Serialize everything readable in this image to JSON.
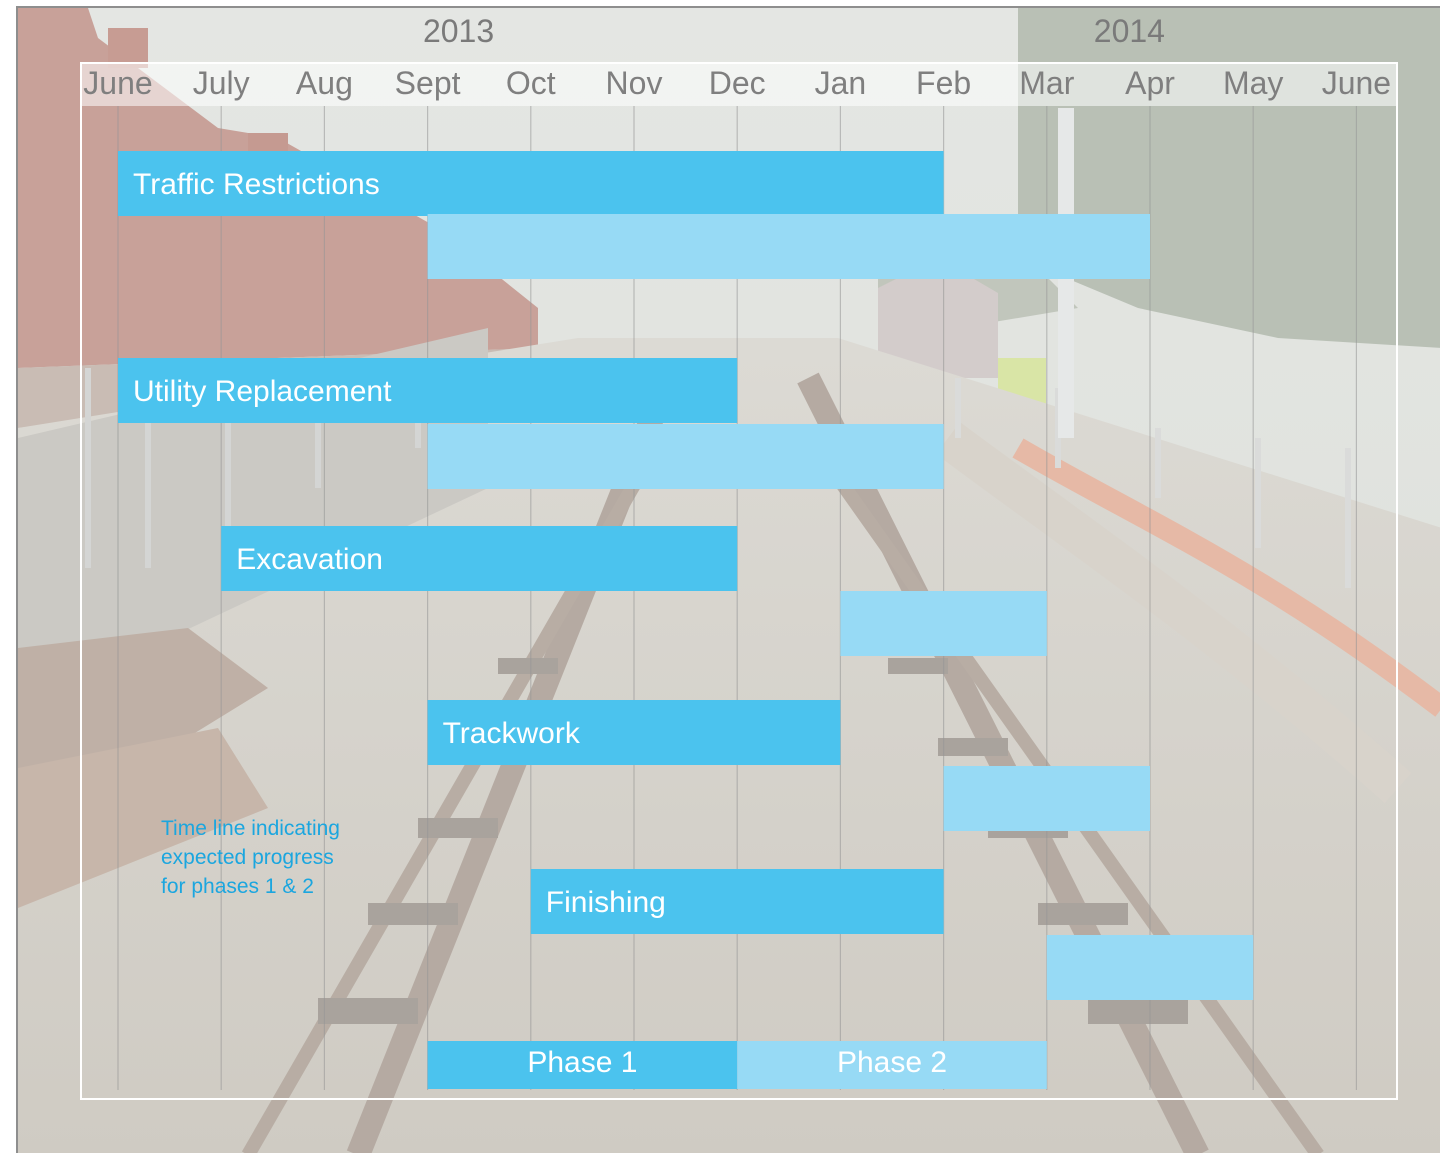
{
  "chart_data": {
    "type": "gantt",
    "years": [
      {
        "label": "2013",
        "month_index": 3.3
      },
      {
        "label": "2014",
        "month_index": 9.8
      }
    ],
    "months": [
      "June",
      "July",
      "Aug",
      "Sept",
      "Oct",
      "Nov",
      "Dec",
      "Jan",
      "Feb",
      "Mar",
      "Apr",
      "May",
      "June"
    ],
    "month_range": [
      0,
      12.4
    ],
    "grid": true,
    "tasks": [
      {
        "name": "Traffic Restrictions",
        "phase": 1,
        "start": 0,
        "end": 8
      },
      {
        "name": "",
        "phase": 2,
        "start": 3,
        "end": 10
      },
      {
        "name": "Utility Replacement",
        "phase": 1,
        "start": 0,
        "end": 6
      },
      {
        "name": "",
        "phase": 2,
        "start": 3,
        "end": 8
      },
      {
        "name": "Excavation",
        "phase": 1,
        "start": 1,
        "end": 6
      },
      {
        "name": "",
        "phase": 2,
        "start": 7,
        "end": 9
      },
      {
        "name": "Trackwork",
        "phase": 1,
        "start": 3,
        "end": 7
      },
      {
        "name": "",
        "phase": 2,
        "start": 8,
        "end": 10
      },
      {
        "name": "Finishing",
        "phase": 1,
        "start": 4,
        "end": 8
      },
      {
        "name": "",
        "phase": 2,
        "start": 9,
        "end": 11
      }
    ],
    "legend": [
      {
        "label": "Phase 1",
        "start": 3,
        "end": 6
      },
      {
        "label": "Phase 2",
        "start": 6,
        "end": 9
      }
    ],
    "colors": {
      "phase1": "#4bc3ee",
      "phase2": "#97daf5"
    }
  },
  "note": {
    "lines": [
      "Time line indicating",
      "expected progress",
      "for phases 1 & 2"
    ]
  }
}
